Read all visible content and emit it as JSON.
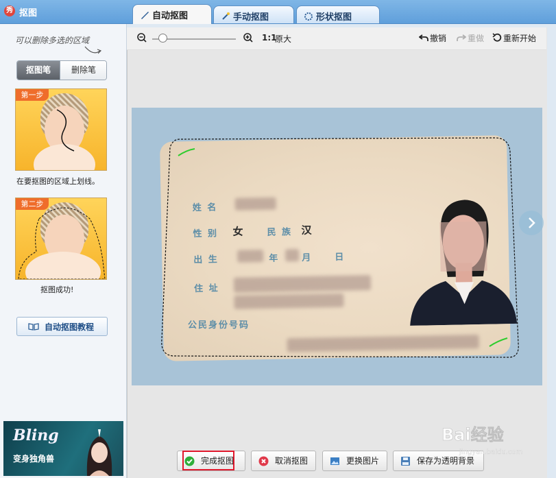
{
  "window": {
    "title": "抠图",
    "logo_text": "秀"
  },
  "tabs": [
    {
      "label": "自动抠图",
      "active": true
    },
    {
      "label": "手动抠图",
      "active": false
    },
    {
      "label": "形状抠图",
      "active": false
    }
  ],
  "sidebar": {
    "hint": "可以删除多选的区域",
    "pen_modes": [
      "抠图笔",
      "删除笔"
    ],
    "steps": [
      {
        "badge": "第一步",
        "caption": "在要抠图的区域上划线。"
      },
      {
        "badge": "第二步",
        "caption": "抠图成功!"
      }
    ],
    "tutorial_button": "自动抠图教程",
    "ad": {
      "title": "Bling",
      "subtitle": "变身独角兽"
    }
  },
  "toolbar": {
    "zoom_ratio": "1:1",
    "zoom_original": "原大",
    "zoom_level": 0.12,
    "undo": "撤销",
    "redo": "重做",
    "restart": "重新开始"
  },
  "id_card": {
    "labels": [
      "姓 名",
      "性 别",
      "民 族",
      "出 生",
      "年",
      "月",
      "日",
      "住 址"
    ],
    "sex": "女",
    "ethnicity": "汉",
    "id_label": "公民身份号码"
  },
  "buttons": {
    "finish": "完成抠图",
    "cancel": "取消抠图",
    "replace": "更换图片",
    "save": "保存为透明背景"
  },
  "watermark": {
    "text": "Bai经验",
    "sub": "jingyan.baidu.com"
  },
  "colors": {
    "titlebar": "#6aa8e0",
    "finish_highlight": "#e0182c",
    "selection_mark": "#2dcc2d"
  }
}
